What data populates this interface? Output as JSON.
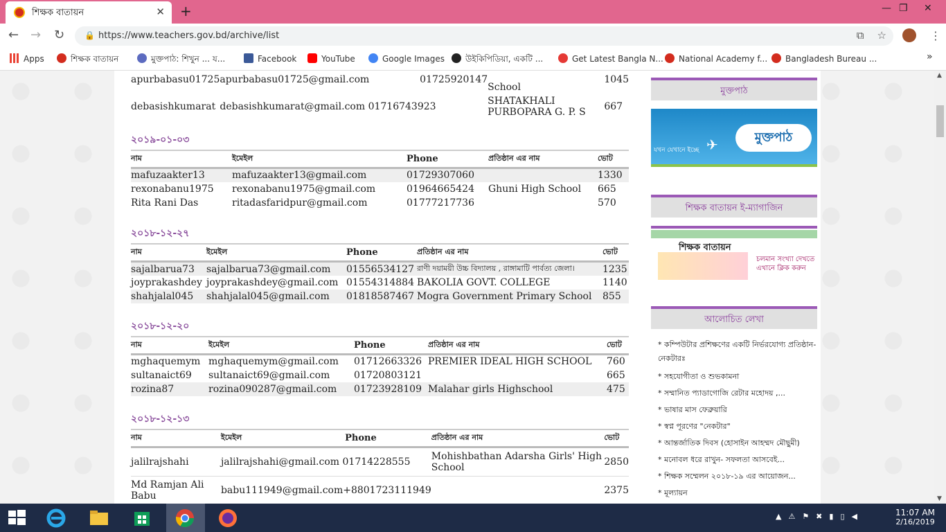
{
  "browser": {
    "tab_title": "শিক্ষক বাতায়ন",
    "url": "https://www.teachers.gov.bd/archive/list",
    "bookmarks": [
      {
        "label": "Apps",
        "color": "#ea4335"
      },
      {
        "label": "শিক্ষক বাতায়ন",
        "color": "#d32c1e"
      },
      {
        "label": "মুক্তপাঠ: শিখুন ... য...",
        "color": "#5c6bc0"
      },
      {
        "label": "Facebook",
        "color": "#3b5998"
      },
      {
        "label": "YouTube",
        "color": "#ff0000"
      },
      {
        "label": "Google Images",
        "color": "#4285f4"
      },
      {
        "label": "উইকিপিডিয়া, একটি ...",
        "color": "#222222"
      },
      {
        "label": "Get Latest Bangla N...",
        "color": "#e53935"
      },
      {
        "label": "National Academy f...",
        "color": "#d32c1e"
      },
      {
        "label": "Bangladesh Bureau ...",
        "color": "#d32c1e"
      }
    ]
  },
  "partial_rows": [
    {
      "name": "apurbabasu01725",
      "email": "apurbabasu01725@gmail.com",
      "phone": "01725920147",
      "inst": "School",
      "votes": "1045"
    },
    {
      "name": "debasishkumarat",
      "email": "debasishkumarat@gmail.com",
      "phone": "01716743923",
      "inst": "SHATAKHALI PURBOPARA G. P. S",
      "votes": "667"
    }
  ],
  "headers": {
    "name": "নাম",
    "email": "ইমেইল",
    "phone": "Phone",
    "inst": "প্রতিষ্ঠান এর নাম",
    "votes": "ভোট"
  },
  "groups": [
    {
      "date": "২০১৯-০১-০৩",
      "rows": [
        {
          "name": "mafuzaakter13",
          "email": "mafuzaakter13@gmail.com",
          "phone": "01729307060",
          "inst": "",
          "votes": "1330"
        },
        {
          "name": "rexonabanu1975",
          "email": "rexonabanu1975@gmail.com",
          "phone": "01964665424",
          "inst": "Ghuni High School",
          "votes": "665"
        },
        {
          "name": "Rita Rani Das",
          "email": "ritadasfaridpur@gmail.com",
          "phone": "01777217736",
          "inst": "",
          "votes": "570"
        }
      ]
    },
    {
      "date": "২০১৮-১২-২৭",
      "rows": [
        {
          "name": "sajalbarua73",
          "email": "sajalbarua73@gmail.com",
          "phone": "01556534127",
          "inst": "রাণী দয়াময়ী উচ্চ বিদ্যালয় , রাঙ্গামাটি পার্বত্য জেলা।",
          "votes": "1235"
        },
        {
          "name": "joyprakashdey",
          "email": "joyprakashdey@gmail.com",
          "phone": "01554314884",
          "inst": "BAKOLIA GOVT. COLLEGE",
          "votes": "1140"
        },
        {
          "name": "shahjalal045",
          "email": "shahjalal045@gmail.com",
          "phone": "01818587467",
          "inst": "Mogra Government Primary School",
          "votes": "855"
        }
      ]
    },
    {
      "date": "২০১৮-১২-২০",
      "rows": [
        {
          "name": "mghaquemym",
          "email": "mghaquemym@gmail.com",
          "phone": "01712663326",
          "inst": "PREMIER IDEAL HIGH SCHOOL",
          "votes": "760"
        },
        {
          "name": "sultanaict69",
          "email": "sultanaict69@gmail.com",
          "phone": "01720803121",
          "inst": "",
          "votes": "665"
        },
        {
          "name": "rozina87",
          "email": "rozina090287@gmail.com",
          "phone": "01723928109",
          "inst": "Malahar girls Highschool",
          "votes": "475"
        }
      ]
    },
    {
      "date": "২০১৮-১২-১৩",
      "rows": [
        {
          "name": "jalilrajshahi",
          "email": "jalilrajshahi@gmail.com",
          "phone": "01714228555",
          "inst": "Mohishbathan Adarsha Girls' High School",
          "votes": "2850"
        },
        {
          "name": "Md Ramjan Ali Babu",
          "email": "babu111949@gmail.com",
          "phone": "+8801723111949",
          "inst": "",
          "votes": "2375"
        }
      ]
    }
  ],
  "sidebar": {
    "muktopath": "মুক্তপাঠ",
    "muktopath_banner": "মুক্তপাঠ",
    "muktopath_tagline": "যখন যেখানে ইচ্ছে",
    "magazine": "শিক্ষক বাতায়ন ই-ম্যাগাজিন",
    "magazine_banner_title": "শিক্ষক বাতায়ন",
    "magazine_banner_text": "চলমান সংখ্যা দেখতে এখানে ক্লিক করুন",
    "discussed": "আলোচিত লেখা",
    "links": [
      "* কম্পিউটার প্রশিক্ষণের একটি নির্ভরযোগ্য প্রতিষ্ঠান- নেকটারঃ",
      "* সহযোগীতা ও শুভকামনা",
      "* সম্মানিত প্যাডাগোজি রেটার মহোদয় ,...",
      "* ভাষার মাস ফেব্রুয়ারি",
      "* স্বপ্ন পূরণের \"নেকটার\"",
      "* আন্তর্জাতিক দিবস (হোসাইন আহম্মদ মৌছুমী)",
      "* মনোবল ধরে রাখুন- সফলতা আসবেই...",
      "* শিক্ষক সম্মেলন ২০১৮-১৯ এর আয়োজন...",
      "* মূল্যায়ন"
    ]
  },
  "tray": {
    "time": "11:07 AM",
    "date": "2/16/2019"
  }
}
